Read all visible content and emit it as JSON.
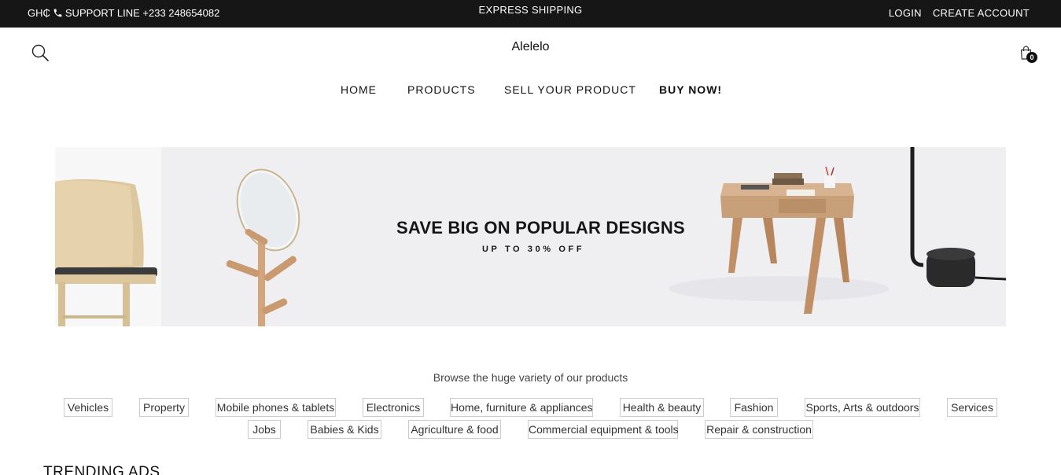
{
  "topbar": {
    "currency": "GH₵",
    "support": "SUPPORT LINE +233 248654082",
    "shipping": "EXPRESS SHIPPING",
    "login": "LOGIN",
    "create_account": "CREATE ACCOUNT",
    "phone_icon": "phone-icon"
  },
  "header": {
    "brand": "Alelelo",
    "search_icon": "search-icon",
    "cart_icon": "shopping-bag-icon",
    "cart_count": "0"
  },
  "nav": {
    "items": [
      "HOME",
      "PRODUCTS",
      "SELL YOUR PRODUCT",
      "BUY NOW!"
    ]
  },
  "banner": {
    "headline": "SAVE BIG ON POPULAR DESIGNS",
    "subline": "UP TO 30% OFF"
  },
  "browse": {
    "title": "Browse the huge variety of our products",
    "categories": [
      "Vehicles",
      "Property",
      "Mobile phones & tablets",
      "Electronics",
      "Home, furniture & appliances",
      "Health & beauty",
      "Fashion",
      "Sports, Arts & outdoors",
      "Services",
      "Jobs",
      "Babies & Kids",
      "Agriculture & food",
      "Commercial equipment & tools",
      "Repair & construction"
    ]
  },
  "trending": {
    "title": "TRENDING ADS"
  },
  "colors": {
    "topbar_bg": "#161616",
    "banner_bg": "#efeff2",
    "tag_border": "#cccccc"
  }
}
